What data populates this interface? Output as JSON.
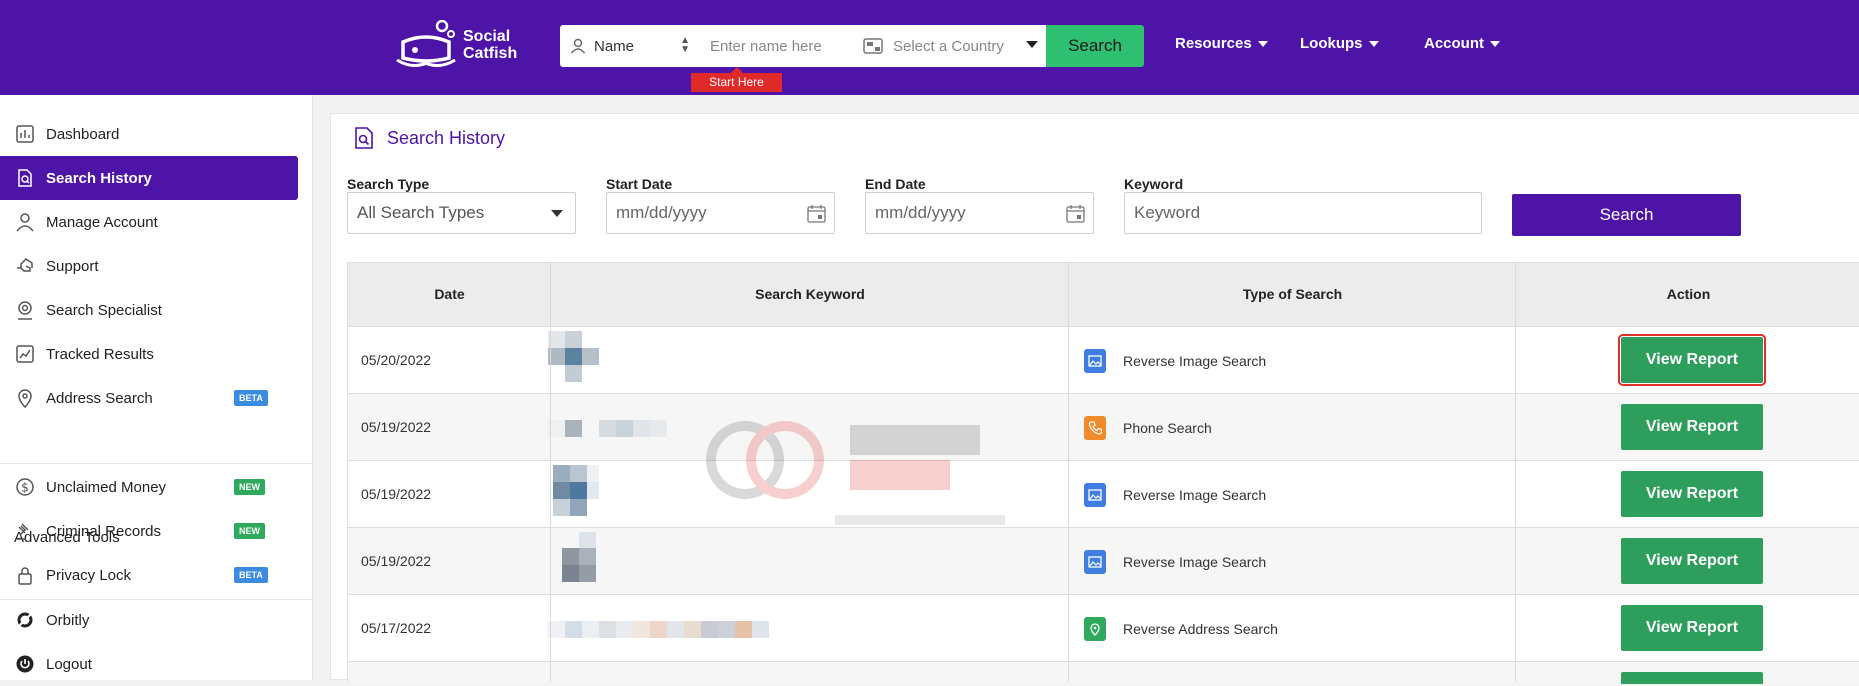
{
  "header": {
    "logo_text_line1": "Social",
    "logo_text_line2": "Catfish",
    "search_type": "Name",
    "name_placeholder": "Enter name here",
    "country_placeholder": "Select a Country",
    "search_label": "Search",
    "start_here": "Start Here",
    "nav": [
      "Resources",
      "Lookups",
      "Account"
    ]
  },
  "sidebar": {
    "items": [
      {
        "label": "Dashboard",
        "icon": "chart-icon"
      },
      {
        "label": "Search History",
        "icon": "search-history-icon",
        "active": true
      },
      {
        "label": "Manage Account",
        "icon": "user-icon"
      },
      {
        "label": "Support",
        "icon": "support-icon"
      },
      {
        "label": "Search Specialist",
        "icon": "specialist-icon"
      },
      {
        "label": "Tracked Results",
        "icon": "tracked-icon"
      },
      {
        "label": "Address Search",
        "icon": "location-icon",
        "badge": "BETA"
      }
    ],
    "advanced_heading": "Advanced Tools",
    "advanced_items": [
      {
        "label": "Unclaimed Money",
        "icon": "dollar-icon",
        "badge": "NEW"
      },
      {
        "label": "Criminal Records",
        "icon": "gavel-icon",
        "badge": "NEW"
      },
      {
        "label": "Privacy Lock",
        "icon": "lock-icon",
        "badge": "BETA"
      }
    ],
    "bottom_items": [
      {
        "label": "Orbitly",
        "icon": "orbitly-icon"
      },
      {
        "label": "Logout",
        "icon": "power-icon"
      }
    ]
  },
  "main": {
    "title": "Search History",
    "filters": {
      "search_type_label": "Search Type",
      "search_type_value": "All Search Types",
      "start_date_label": "Start Date",
      "start_date_placeholder": "mm/dd/yyyy",
      "end_date_label": "End Date",
      "end_date_placeholder": "mm/dd/yyyy",
      "keyword_label": "Keyword",
      "keyword_placeholder": "Keyword",
      "search_button": "Search"
    },
    "table": {
      "headers": [
        "Date",
        "Search Keyword",
        "Type of Search",
        "Action"
      ],
      "rows": [
        {
          "date": "05/20/2022",
          "type": "Reverse Image Search",
          "type_icon": "image-icon",
          "action": "View Report"
        },
        {
          "date": "05/19/2022",
          "type": "Phone Search",
          "type_icon": "phone-icon",
          "action": "View Report"
        },
        {
          "date": "05/19/2022",
          "type": "Reverse Image Search",
          "type_icon": "image-icon",
          "action": "View Report"
        },
        {
          "date": "05/19/2022",
          "type": "Reverse Image Search",
          "type_icon": "image-icon",
          "action": "View Report"
        },
        {
          "date": "05/17/2022",
          "type": "Reverse Address Search",
          "type_icon": "location-icon",
          "action": "View Report"
        }
      ]
    }
  },
  "colors": {
    "brand": "#4e14a8",
    "green": "#2d9e5c",
    "top_search": "#2fbf71",
    "highlight": "#e0302c"
  }
}
